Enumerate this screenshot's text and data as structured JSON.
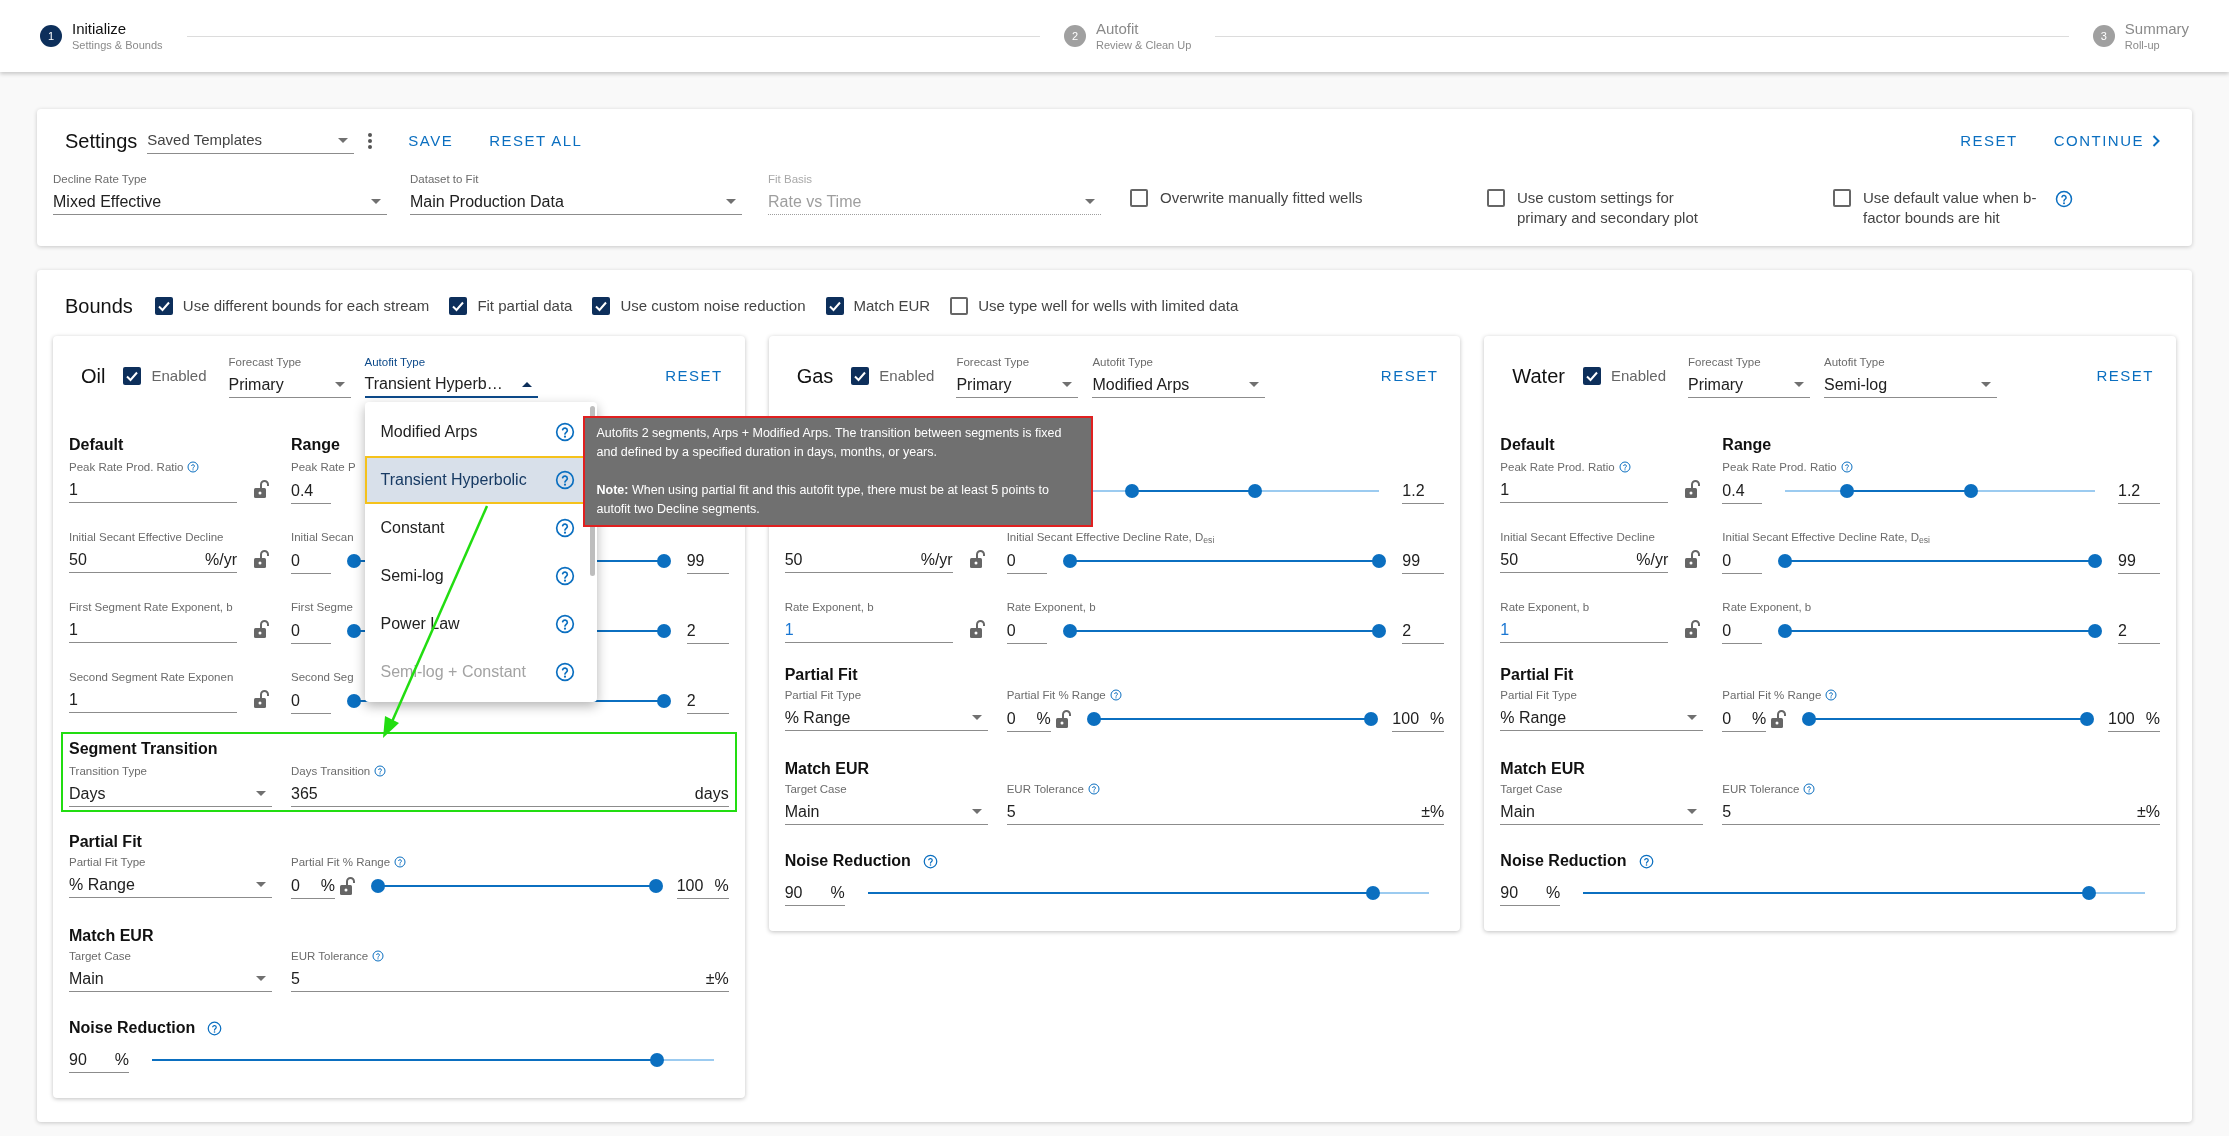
{
  "stepper": {
    "steps": [
      {
        "number": "1",
        "title": "Initialize",
        "subtitle": "Settings & Bounds",
        "selected": true
      },
      {
        "number": "2",
        "title": "Autofit",
        "subtitle": "Review & Clean Up",
        "selected": false
      },
      {
        "number": "3",
        "title": "Summary",
        "subtitle": "Roll-up",
        "selected": false
      }
    ]
  },
  "settings": {
    "title": "Settings",
    "template_select": "Saved Templates",
    "actions": [
      "SAVE",
      "RESET ALL"
    ],
    "reset": "RESET",
    "continue": "CONTINUE",
    "fields": [
      {
        "label": "Decline Rate Type",
        "value": "Mixed Effective",
        "disabled": false
      },
      {
        "label": "Dataset to Fit",
        "value": "Main Production Data",
        "disabled": false
      },
      {
        "label": "Fit Basis",
        "value": "Rate vs Time",
        "disabled": true
      }
    ],
    "options": [
      {
        "label": "Overwrite manually fitted wells",
        "checked": false,
        "help": false
      },
      {
        "label": "Use custom settings for primary and secondary plot",
        "checked": false,
        "help": false
      },
      {
        "label": "Use default value when b-factor bounds are hit",
        "checked": false,
        "help": true
      }
    ]
  },
  "bounds": {
    "title": "Bounds",
    "options": [
      {
        "label": "Use different bounds for each stream",
        "checked": true
      },
      {
        "label": "Fit partial data",
        "checked": true
      },
      {
        "label": "Use custom noise reduction",
        "checked": true
      },
      {
        "label": "Match EUR",
        "checked": true
      },
      {
        "label": "Use type well for wells with limited data",
        "checked": false
      }
    ],
    "streams": [
      {
        "name": "Oil",
        "enabled": true,
        "enabled_label": "Enabled",
        "reset": "RESET",
        "forecast_type": {
          "label": "Forecast Type",
          "value": "Primary"
        },
        "autofit_type": {
          "label": "Autofit Type",
          "value": "Transient Hyperb…",
          "open": true,
          "menu": [
            {
              "label": "Modified Arps",
              "selected": false,
              "disabled": false
            },
            {
              "label": "Transient Hyperbolic",
              "selected": true,
              "disabled": false
            },
            {
              "label": "Constant",
              "selected": false,
              "disabled": false
            },
            {
              "label": "Semi-log",
              "selected": false,
              "disabled": false
            },
            {
              "label": "Power Law",
              "selected": false,
              "disabled": false
            },
            {
              "label": "Semi-log + Constant",
              "selected": false,
              "disabled": true
            }
          ],
          "tooltip": {
            "text": "Autofits 2 segments, Arps + Modified Arps. The transition between segments is fixed and defined by a specified duration in days, months, or years.",
            "note": "**Note:** When using partial fit and this autofit type, there must be at least 5 points to autofit two Decline segments."
          }
        },
        "default": {
          "heading": "Default",
          "rows": [
            {
              "kind": "field",
              "label": "Peak Rate Prod. Ratio",
              "help": true,
              "value": "1",
              "changed": false
            },
            {
              "kind": "field",
              "label": "Initial Secant Effective Decline",
              "help": false,
              "value": "50",
              "unit": "%/yr",
              "changed": false
            },
            {
              "kind": "field",
              "label": "First Segment Rate Exponent, b",
              "help": false,
              "value": "1",
              "changed": false
            },
            {
              "kind": "field",
              "label": "Second Segment Rate Exponen",
              "help": false,
              "value": "1",
              "changed": false
            }
          ]
        },
        "range": {
          "heading": "Range",
          "rows": [
            {
              "label": "Peak Rate P",
              "help": false,
              "low": "0.4"
            },
            {
              "label": "Initial Secan",
              "help": false,
              "low": "0",
              "high": "99",
              "thumbs": [
                {
                  "level": 0
                },
                {
                  "level": 1
                }
              ]
            },
            {
              "label": "First Segme",
              "help": false,
              "low": "0",
              "high": "2",
              "thumbs": [
                {
                  "level": 0
                },
                {
                  "level": 1
                }
              ]
            },
            {
              "label": "Second Seg",
              "help": false,
              "low": "0",
              "high": "2",
              "thumbs": [
                {
                  "level": 0
                },
                {
                  "level": 1
                }
              ]
            }
          ]
        },
        "segment_transition": {
          "heading": "Segment Transition",
          "highlighted": true,
          "type": {
            "label": "Transition Type",
            "value": "Days"
          },
          "duration": {
            "label": "Days Transition",
            "value": "365",
            "unit": "days"
          }
        },
        "partial_fit": {
          "heading": "Partial Fit",
          "type": {
            "label": "Partial Fit Type",
            "value": "% Range"
          },
          "range": {
            "label": "Partial Fit % Range",
            "low": "0",
            "low_unit": "%",
            "high": "100",
            "high_unit": "%",
            "thumbs": [
              {
                "level": 0
              },
              {
                "level": 1
              }
            ]
          }
        },
        "match_eur": {
          "heading": "Match EUR",
          "target": {
            "label": "Target Case",
            "value": "Main"
          },
          "tolerance": {
            "label": "EUR Tolerance",
            "value": "5",
            "unit": "±%"
          }
        },
        "noise_reduction": {
          "heading": "Noise Reduction",
          "value": "90",
          "unit": "%",
          "level": 0.9
        }
      },
      {
        "name": "Gas",
        "enabled": true,
        "enabled_label": "Enabled",
        "reset": "RESET",
        "forecast_type": {
          "label": "Forecast Type",
          "value": "Primary"
        },
        "autofit_type": {
          "label": "Autofit Type",
          "value": "Modified Arps",
          "open": false
        },
        "default": {
          "rows": [
            {
              "kind": "covered"
            },
            {
              "kind": "field",
              "help": false,
              "value": "50",
              "unit": "%/yr",
              "changed": false
            },
            {
              "kind": "field",
              "label": "Rate Exponent, b",
              "help": false,
              "value": "1",
              "changed": true
            }
          ]
        },
        "range": {
          "rows": [
            {
              "help": false,
              "high": "1.2",
              "thumbs": [
                {
                  "level": 0.2
                },
                {
                  "level": 0.6
                }
              ]
            },
            {
              "label": "Initial Secant Effective Decline Rate, D$_{esi}$",
              "help": false,
              "low": "0",
              "high": "99",
              "thumbs": [
                {
                  "level": 0
                },
                {
                  "level": 1
                }
              ]
            },
            {
              "label": "Rate Exponent, b",
              "help": false,
              "low": "0",
              "high": "2",
              "thumbs": [
                {
                  "level": 0
                },
                {
                  "level": 1
                }
              ]
            }
          ]
        },
        "partial_fit": {
          "heading": "Partial Fit",
          "type": {
            "label": "Partial Fit Type",
            "value": "% Range"
          },
          "range": {
            "label": "Partial Fit % Range",
            "low": "0",
            "low_unit": "%",
            "high": "100",
            "high_unit": "%",
            "thumbs": [
              {
                "level": 0
              },
              {
                "level": 1
              }
            ]
          }
        },
        "match_eur": {
          "heading": "Match EUR",
          "target": {
            "label": "Target Case",
            "value": "Main"
          },
          "tolerance": {
            "label": "EUR Tolerance",
            "value": "5",
            "unit": "±%"
          }
        },
        "noise_reduction": {
          "heading": "Noise Reduction",
          "value": "90",
          "unit": "%",
          "level": 0.9
        }
      },
      {
        "name": "Water",
        "enabled": true,
        "enabled_label": "Enabled",
        "reset": "RESET",
        "forecast_type": {
          "label": "Forecast Type",
          "value": "Primary"
        },
        "autofit_type": {
          "label": "Autofit Type",
          "value": "Semi-log",
          "open": false
        },
        "default": {
          "heading": "Default",
          "rows": [
            {
              "kind": "field",
              "label": "Peak Rate Prod. Ratio",
              "help": true,
              "value": "1",
              "changed": false
            },
            {
              "kind": "field",
              "label": "Initial Secant Effective Decline",
              "help": false,
              "value": "50",
              "unit": "%/yr",
              "changed": false
            },
            {
              "kind": "field",
              "label": "Rate Exponent, b",
              "help": false,
              "value": "1",
              "changed": true
            }
          ]
        },
        "range": {
          "heading": "Range",
          "rows": [
            {
              "label": "Peak Rate Prod. Ratio",
              "help": true,
              "low": "0.4",
              "high": "1.2",
              "thumbs": [
                {
                  "level": 0.2
                },
                {
                  "level": 0.6
                }
              ]
            },
            {
              "label": "Initial Secant Effective Decline Rate, D$_{esi}$",
              "help": false,
              "low": "0",
              "high": "99",
              "thumbs": [
                {
                  "level": 0
                },
                {
                  "level": 1
                }
              ]
            },
            {
              "label": "Rate Exponent, b",
              "help": false,
              "low": "0",
              "high": "2",
              "thumbs": [
                {
                  "level": 0
                },
                {
                  "level": 1
                }
              ]
            }
          ]
        },
        "partial_fit": {
          "heading": "Partial Fit",
          "type": {
            "label": "Partial Fit Type",
            "value": "% Range"
          },
          "range": {
            "label": "Partial Fit % Range",
            "low": "0",
            "low_unit": "%",
            "high": "100",
            "high_unit": "%",
            "thumbs": [
              {
                "level": 0
              },
              {
                "level": 1
              }
            ]
          }
        },
        "match_eur": {
          "heading": "Match EUR",
          "target": {
            "label": "Target Case",
            "value": "Main"
          },
          "tolerance": {
            "label": "EUR Tolerance",
            "value": "5",
            "unit": "±%"
          }
        },
        "noise_reduction": {
          "heading": "Noise Reduction",
          "value": "90",
          "unit": "%",
          "level": 0.9
        }
      }
    ]
  }
}
